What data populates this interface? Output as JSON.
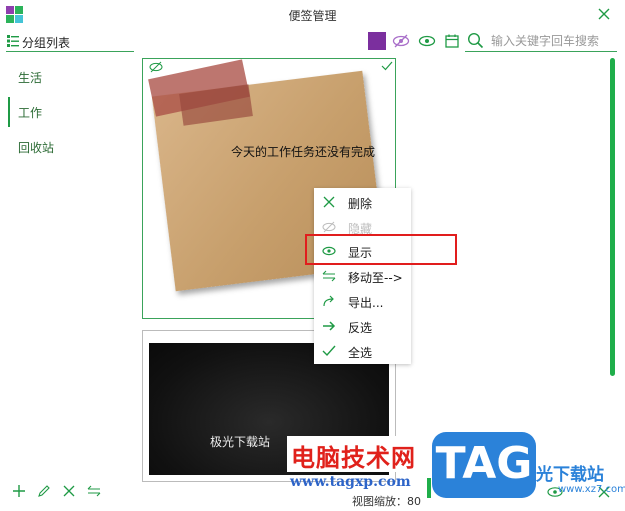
{
  "window": {
    "title": "便签管理"
  },
  "sidebar": {
    "title": "分组列表",
    "items": [
      {
        "label": "生活"
      },
      {
        "label": "工作"
      },
      {
        "label": "回收站"
      }
    ]
  },
  "toolbar": {
    "color_swatch": "#7b2f9e",
    "icons": [
      "hide-icon",
      "show-icon",
      "calendar-icon"
    ]
  },
  "search": {
    "placeholder": "输入关键字回车搜索"
  },
  "notes": [
    {
      "text": "今天的工作任务还没有完成"
    },
    {
      "text": "极光下载站"
    }
  ],
  "context_menu": {
    "items": [
      {
        "label": "删除",
        "icon": "close-icon",
        "disabled": false
      },
      {
        "label": "隐藏",
        "icon": "hide-icon",
        "disabled": true
      },
      {
        "label": "显示",
        "icon": "eye-icon",
        "disabled": false,
        "highlighted": true
      },
      {
        "label": "移动至-->",
        "icon": "move-icon",
        "disabled": false
      },
      {
        "label": "导出...",
        "icon": "export-icon",
        "disabled": false
      },
      {
        "label": "反选",
        "icon": "arrow-right-icon",
        "disabled": false
      },
      {
        "label": "全选",
        "icon": "check-icon",
        "disabled": false
      }
    ]
  },
  "footer": {
    "zoom_label": "视图缩放：80"
  },
  "watermark": {
    "cn_text": "电脑技术网",
    "url": "www.tagxp.com",
    "tag": "TAG",
    "site": "光下载站",
    "site_url": "www.xz7.com"
  },
  "colors": {
    "accent": "#1fae4a",
    "highlight_box": "#e11d1d"
  }
}
